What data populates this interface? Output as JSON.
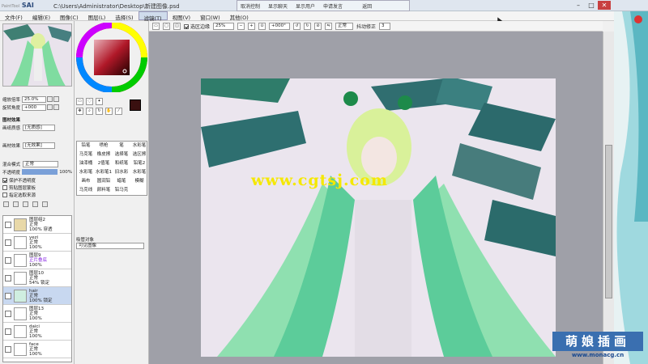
{
  "app": {
    "logo_main": "SAI",
    "logo_prefix": "PaintTool",
    "window_path": "C:\\Users\\Administrator\\Desktop\\新建图像.psd"
  },
  "recorder": {
    "items": [
      "取消控制",
      "显示聊天",
      "显示用户",
      "申请发言",
      "返回"
    ]
  },
  "window_controls": {
    "minimize": "–",
    "maximize": "□",
    "close": "✕"
  },
  "menu": {
    "items": [
      {
        "label": "文件(F)",
        "active": false
      },
      {
        "label": "编辑(E)",
        "active": false
      },
      {
        "label": "图像(C)",
        "active": false
      },
      {
        "label": "图层(L)",
        "active": false
      },
      {
        "label": "选择(S)",
        "active": false
      },
      {
        "label": "滤镜(T)",
        "active": true
      },
      {
        "label": "视图(V)",
        "active": false
      },
      {
        "label": "窗口(W)",
        "active": false
      },
      {
        "label": "其他(O)",
        "active": false
      }
    ]
  },
  "toolbar": {
    "selection_edge_label": "选区边缘",
    "selection_edge_checked": true,
    "zoom": "25%",
    "rotation": "+000°",
    "blend": "正常",
    "stabilizer_label": "抖动修正",
    "stabilizer_value": "3"
  },
  "navigator": {
    "zoom_label": "缩放倍率",
    "zoom_value": "25.0%",
    "angle_label": "旋转角度",
    "angle_value": "+000"
  },
  "layer_props": {
    "section_label": "图材效果",
    "paper_label": "画纸质感",
    "paper_value": "[无质感]",
    "effect_label": "画材效果",
    "effect_value": "[无效果]",
    "mode_label": "混合模式",
    "mode_value": "正常",
    "opacity_label": "不透明度",
    "opacity_value": "100%",
    "lock_opacity": "保护不透明度",
    "clip_label": "剪贴图层蒙板",
    "select_source": "指定选取来源"
  },
  "layers": [
    {
      "name": "图层组2",
      "mode": "正常",
      "opacity": "100%",
      "extra": "穿透",
      "selected": false
    },
    {
      "name": "yezi",
      "mode": "正常",
      "opacity": "100%",
      "extra": "",
      "selected": false
    },
    {
      "name": "图层9",
      "mode": "正片叠底",
      "opacity": "100%",
      "extra": "",
      "selected": false
    },
    {
      "name": "图层10",
      "mode": "正常",
      "opacity": "54%",
      "extra": "锁定",
      "selected": false
    },
    {
      "name": "hair",
      "mode": "正常",
      "opacity": "100%",
      "extra": "锁定",
      "selected": true
    },
    {
      "name": "图层13",
      "mode": "正常",
      "opacity": "100%",
      "extra": "",
      "selected": false
    },
    {
      "name": "daici",
      "mode": "正常",
      "opacity": "100%",
      "extra": "",
      "selected": false
    },
    {
      "name": "face",
      "mode": "正常",
      "opacity": "100%",
      "extra": "",
      "selected": false
    }
  ],
  "tools": [
    "铅笔",
    "喷枪",
    "笔",
    "水彩笔",
    "马克笔",
    "橡皮擦",
    "选择笔",
    "选区擦",
    "油漆桶",
    "2值笔",
    "和纸笔",
    "铅笔2",
    "水彩笔",
    "水彩笔1",
    "旧水彩",
    "水彩笔",
    "画布",
    "圆润铅",
    "蜡笔",
    "模糊",
    "马克线",
    "颜料笔",
    "铅马克",
    ""
  ],
  "brush_target": {
    "label": "吸管对象",
    "value": "可见图像"
  },
  "watermark": "www.cgtsj.com",
  "brand": {
    "title": "萌娘插画",
    "url": "www.monacg.cn"
  },
  "colors": {
    "foreground": "#3a1010",
    "background": "#ffffff",
    "accent": "#3a6fb0",
    "watermark": "#f5e800"
  }
}
